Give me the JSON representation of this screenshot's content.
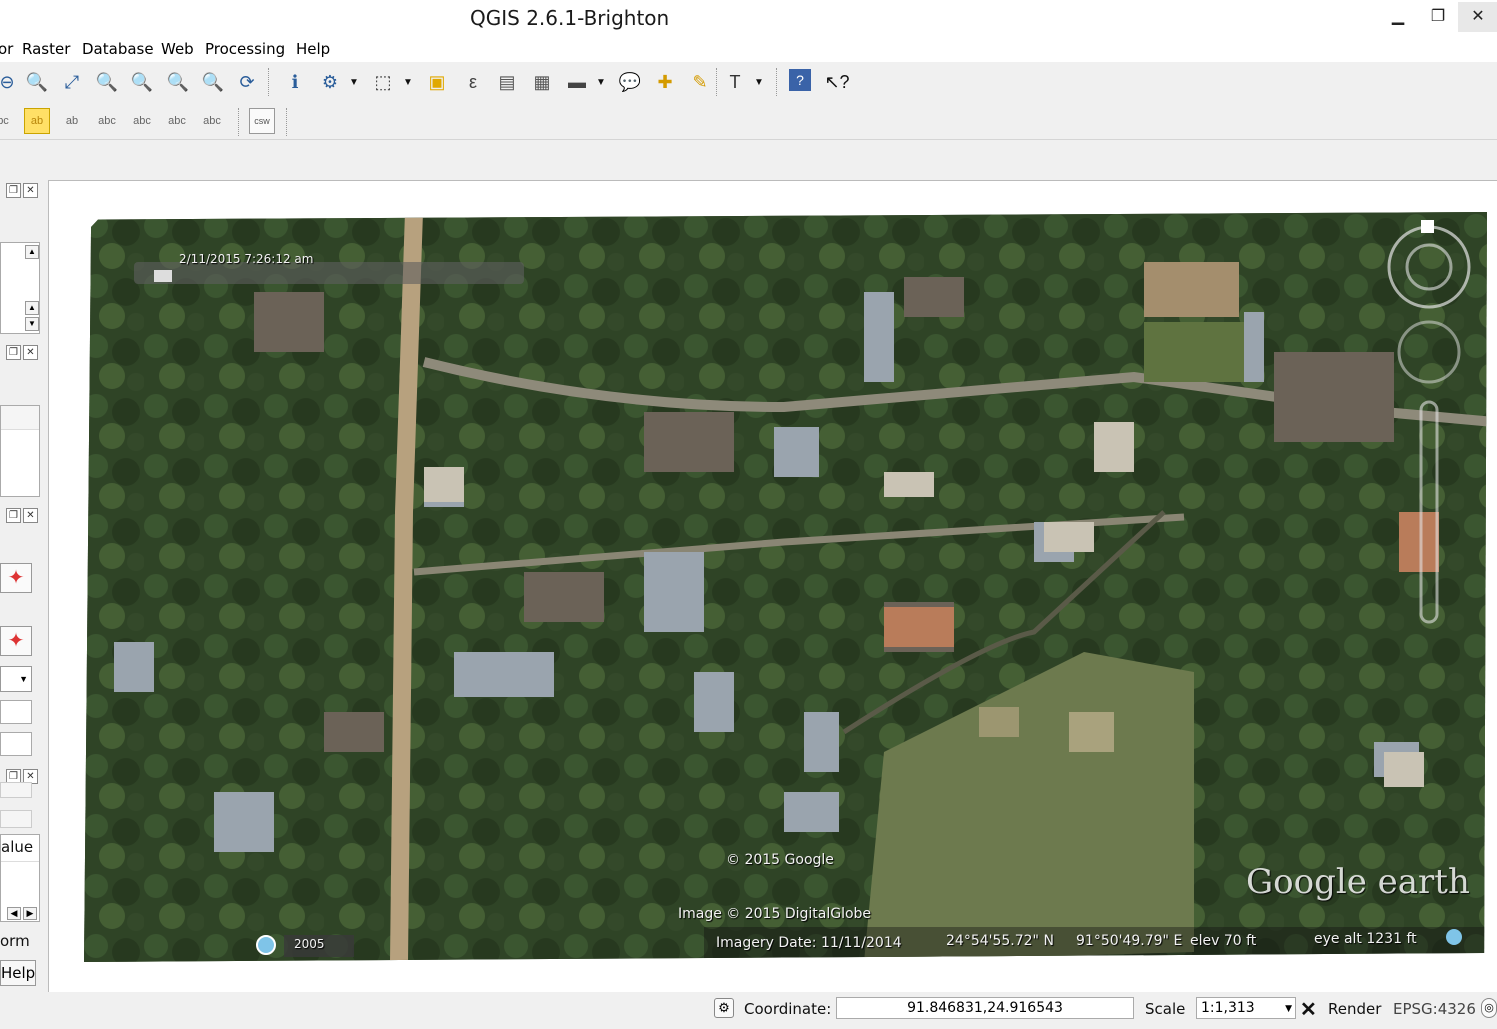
{
  "window": {
    "title": "QGIS 2.6.1-Brighton",
    "minimize": "▁",
    "restore": "❐",
    "close": "✕"
  },
  "menu": [
    "or",
    "Raster",
    "Database",
    "Web",
    "Processing",
    "Help"
  ],
  "toolbar1": {
    "icons": [
      "zoom-out-icon",
      "zoom-native-icon",
      "zoom-full-icon",
      "zoom-layer-icon",
      "zoom-selection-icon",
      "zoom-last-icon",
      "zoom-next-icon",
      "refresh-icon",
      "identify-icon",
      "select-features-icon",
      "select-region-icon",
      "deselect-icon",
      "expression-icon",
      "attribute-table-icon",
      "statistics-icon",
      "measure-icon",
      "annotation-icon",
      "new-bookmark-icon",
      "show-bookmarks-icon",
      "text-annotation-icon",
      "help-icon",
      "whats-this-icon"
    ]
  },
  "toolbar2": {
    "icons": [
      "label-icon",
      "label-tool-icon",
      "pin-labels-icon",
      "show-hide-labels-icon",
      "move-label-icon",
      "rotate-label-icon",
      "change-label-icon",
      "csw-icon"
    ],
    "csw_label": "csw"
  },
  "left_panel": {
    "value_header": "alue",
    "form_label": "orm",
    "help_label": "Help"
  },
  "map": {
    "date_time": "2/11/2015   7:26:12 am",
    "copyright_google": "© 2015 Google",
    "copyright_imagery": "Image © 2015 DigitalGlobe",
    "imagery_date": "Imagery Date: 11/11/2014",
    "lat": "24°54'55.72\" N",
    "lon": "91°50'49.79\" E",
    "elev": "elev   70 ft",
    "eye_alt": "eye alt   1231 ft",
    "logo": "Google earth",
    "history_year": "2005"
  },
  "status": {
    "coordinate_label": "Coordinate:",
    "coordinate_value": "91.846831,24.916543",
    "scale_label": "Scale",
    "scale_value": "1:1,313",
    "render_label": "Render",
    "crs": "EPSG:4326"
  }
}
